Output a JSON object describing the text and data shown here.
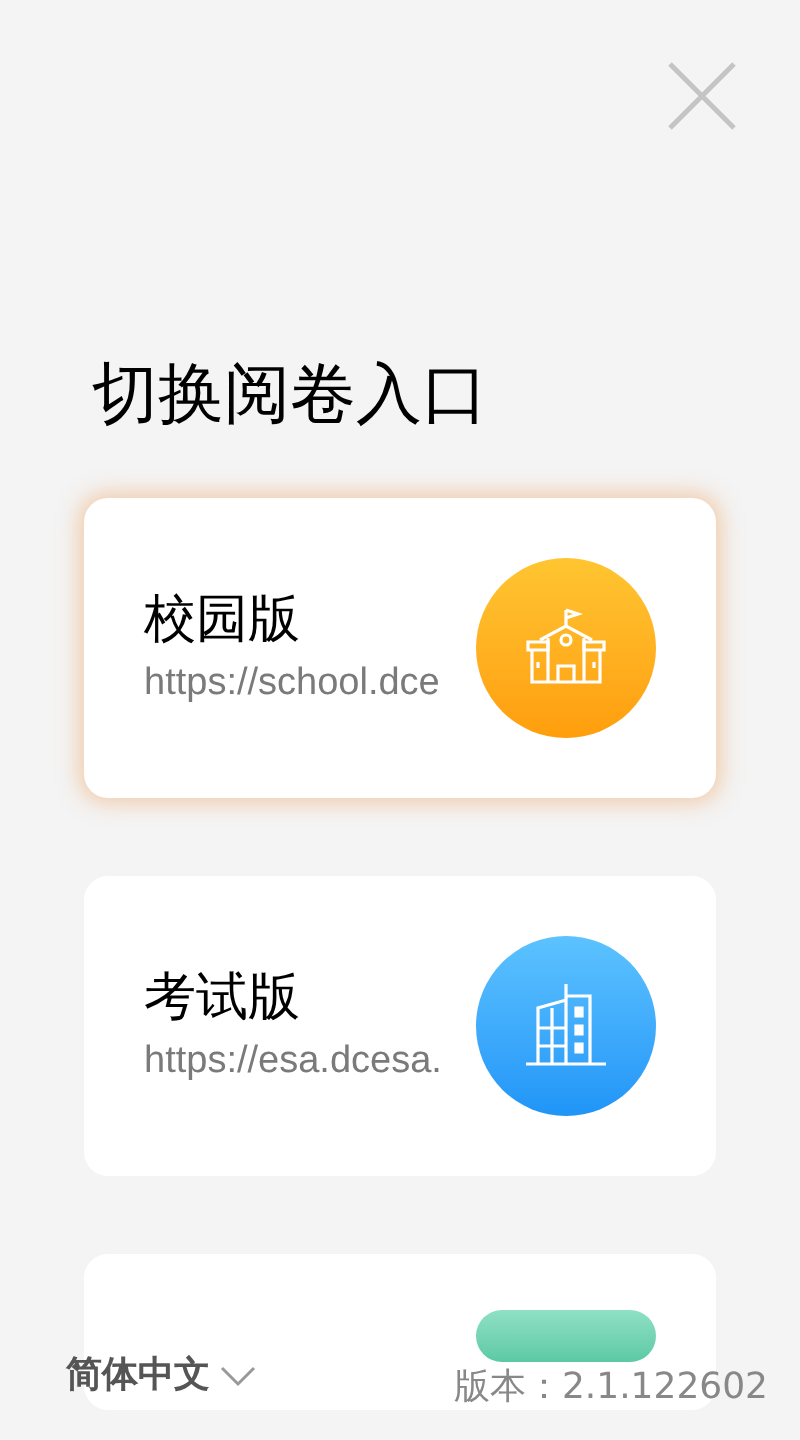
{
  "title": "切换阅卷入口",
  "cards": [
    {
      "kind": "school",
      "name": "校园版",
      "url": "https://school.dce",
      "selected": true
    },
    {
      "kind": "exam",
      "name": "考试版",
      "url": "https://esa.dcesa.",
      "selected": false
    },
    {
      "kind": "custom",
      "selected": false
    }
  ],
  "footer": {
    "language": "简体中文",
    "version": "版本：2.1.122602"
  }
}
